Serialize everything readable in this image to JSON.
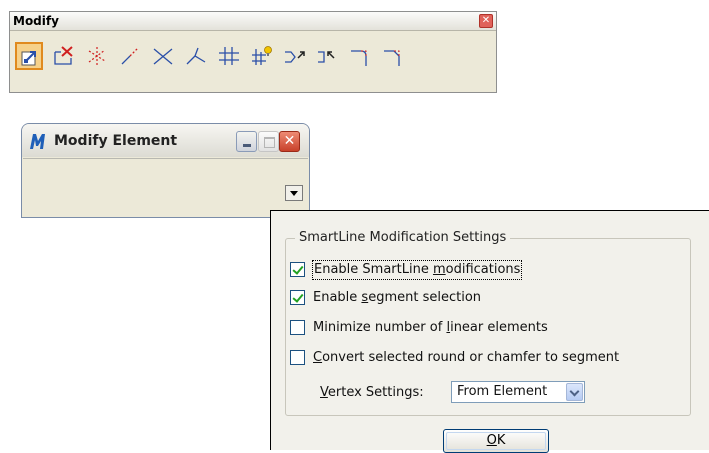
{
  "toolbox": {
    "title": "Modify",
    "close_glyph": "✕",
    "tools": [
      {
        "name": "modify-element-tool-icon",
        "selected": true
      },
      {
        "name": "delete-part-of-element-tool-icon"
      },
      {
        "name": "extend-line-tool-icon"
      },
      {
        "name": "extend-two-elements-to-intersection-icon"
      },
      {
        "name": "extend-element-to-intersection-icon"
      },
      {
        "name": "trim-to-element-icon"
      },
      {
        "name": "trim-multiple-icon"
      },
      {
        "name": "intellitrim-icon"
      },
      {
        "name": "insert-vertex-icon"
      },
      {
        "name": "delete-vertex-icon"
      },
      {
        "name": "construct-circular-fillet-icon"
      },
      {
        "name": "construct-chamfer-icon"
      }
    ]
  },
  "modify_element": {
    "title": "Modify Element",
    "close_glyph": "✕"
  },
  "settings_dialog": {
    "group_title": "SmartLine Modification Settings",
    "options": [
      {
        "pre": "Enable SmartLine ",
        "key": "m",
        "post": "odifications",
        "checked": true,
        "focused": true
      },
      {
        "pre": "Enable ",
        "key": "s",
        "post": "egment selection",
        "checked": true
      },
      {
        "pre": "Minimize number of ",
        "key": "l",
        "post": "inear elements",
        "checked": false
      },
      {
        "pre": "",
        "key": "C",
        "post": "onvert selected round or chamfer to segment",
        "checked": false
      }
    ],
    "vertex_label_key": "V",
    "vertex_label_rest": "ertex Settings:",
    "vertex_value": "From Element",
    "ok_key": "O",
    "ok_rest": "K"
  },
  "colors": {
    "active_tool_bg": "#f6d18a",
    "active_tool_border": "#e08a1e",
    "close_red": "#d9493a",
    "tool_red": "#d02020",
    "tool_blue": "#2a4fa8",
    "check_green": "#21a121"
  }
}
